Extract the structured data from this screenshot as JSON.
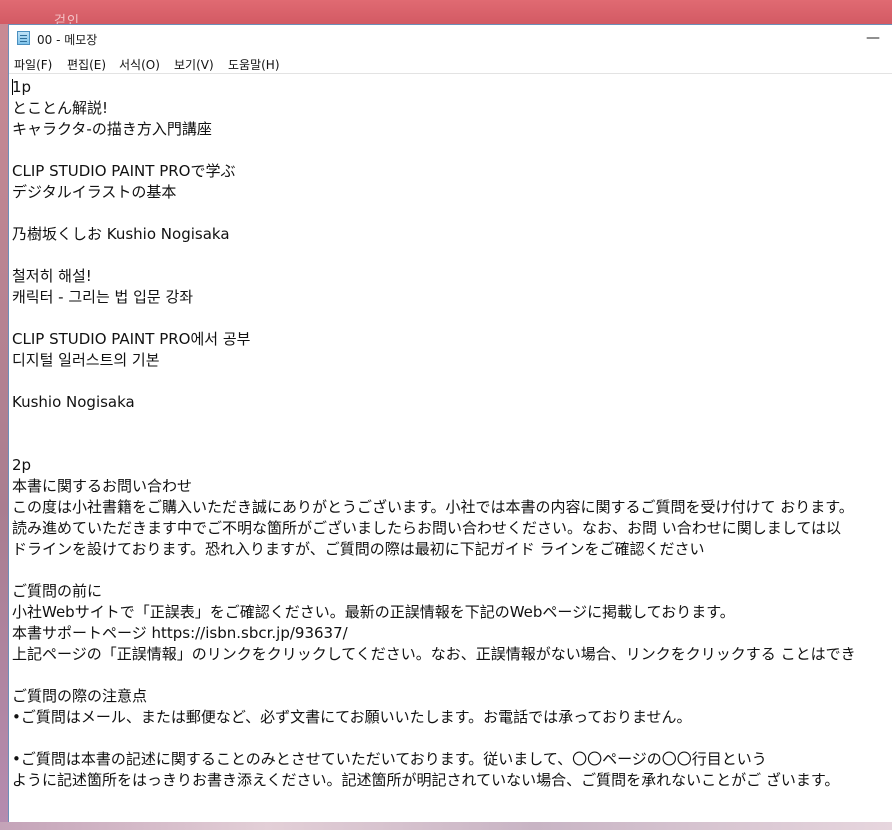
{
  "background": {
    "ghost_text": "걷인"
  },
  "window": {
    "title": "00 - 메모장",
    "minimize_glyph": "—"
  },
  "menu": [
    "파일(F)",
    "편집(E)",
    "서식(O)",
    "보기(V)",
    "도움말(H)"
  ],
  "document": {
    "lines": [
      "1p",
      "とことん解説!",
      "キャラクタ-の描き方入門講座",
      "",
      "CLIP STUDIO PAINT PROで学ぶ",
      "デジタルイラストの基本",
      "",
      "乃樹坂くしお Kushio Nogisaka",
      "",
      "철저히 해설!",
      "캐릭터 - 그리는 법 입문 강좌",
      "",
      "CLIP STUDIO PAINT PRO에서 공부",
      "디지털 일러스트의 기본",
      "",
      "Kushio Nogisaka",
      "",
      "",
      "2p",
      "本書に関するお問い合わせ",
      "この度は小社書籍をご購入いただき誠にありがとうございます。小社では本書の内容に関するご質問を受け付けて おります。",
      "読み進めていただきます中でご不明な箇所がございましたらお問い合わせください。なお、お問 い合わせに関しましては以",
      "ドラインを設けております。恐れ入りますが、ご質問の際は最初に下記ガイド ラインをご確認ください",
      "",
      "ご質問の前に",
      "小社Webサイトで「正誤表」をご確認ください。最新の正誤情報を下記のWebページに掲載しております。",
      "本書サポートページ https://isbn.sbcr.jp/93637/",
      "上記ページの「正誤情報」のリンクをクリックしてください。なお、正誤情報がない場合、リンクをクリックする ことはでき",
      "",
      "ご質問の際の注意点",
      "•ご質問はメール、または郵便など、必ず文書にてお願いいたします。お電話では承っておりません。",
      "",
      "•ご質問は本書の記述に関することのみとさせていただいております。従いまして、〇〇ページの〇〇行目という",
      "ように記述箇所をはっきりお書き添えください。記述箇所が明記されていない場合、ご質問を承れないことがご ざいます。"
    ]
  }
}
